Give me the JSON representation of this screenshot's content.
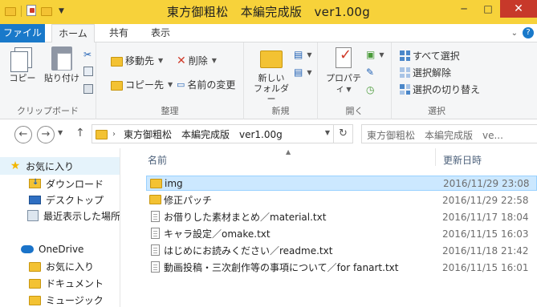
{
  "window": {
    "title": "東方御粗松　本編完成版　ver1.00g",
    "minimize": "─",
    "maximize": "□",
    "close": "✕"
  },
  "tabs": {
    "file": "ファイル",
    "home": "ホーム",
    "share": "共有",
    "view": "表示"
  },
  "ribbon": {
    "clipboard": {
      "label": "クリップボード",
      "copy": "コピー",
      "paste": "貼り付け"
    },
    "organize": {
      "label": "整理",
      "move_to": "移動先",
      "copy_to": "コピー先",
      "delete": "削除",
      "rename": "名前の変更"
    },
    "new": {
      "label": "新規",
      "new_folder_line1": "新しい",
      "new_folder_line2": "フォルダー"
    },
    "open": {
      "label": "開く",
      "properties": "プロパティ"
    },
    "select": {
      "label": "選択",
      "select_all": "すべて選択",
      "select_none": "選択解除",
      "invert": "選択の切り替え"
    }
  },
  "address": {
    "path": "東方御粗松　本編完成版　ver1.00g",
    "search_placeholder": "東方御粗松　本編完成版　ve..."
  },
  "nav": {
    "favorites": "お気に入り",
    "downloads": "ダウンロード",
    "desktop": "デスクトップ",
    "recent": "最近表示した場所",
    "onedrive": "OneDrive",
    "od_favorites": "お気に入り",
    "documents": "ドキュメント",
    "music": "ミュージック"
  },
  "columns": {
    "name": "名前",
    "modified": "更新日時"
  },
  "files": [
    {
      "name": "img",
      "date": "2016/11/29 23:08",
      "type": "folder"
    },
    {
      "name": "修正パッチ",
      "date": "2016/11/29 22:58",
      "type": "folder"
    },
    {
      "name": "お借りした素材まとめ／material.txt",
      "date": "2016/11/17 18:04",
      "type": "txt"
    },
    {
      "name": "キャラ設定／omake.txt",
      "date": "2016/11/15 16:03",
      "type": "txt"
    },
    {
      "name": "はじめにお読みください／readme.txt",
      "date": "2016/11/18 21:42",
      "type": "txt"
    },
    {
      "name": "動画投稿・三次創作等の事項について／for fanart.txt",
      "date": "2016/11/15 16:01",
      "type": "txt"
    }
  ],
  "colors": {
    "titlebar": "#f7d23a",
    "file_tab": "#1979ca",
    "selection": "#cce8ff",
    "close": "#c7392a"
  }
}
